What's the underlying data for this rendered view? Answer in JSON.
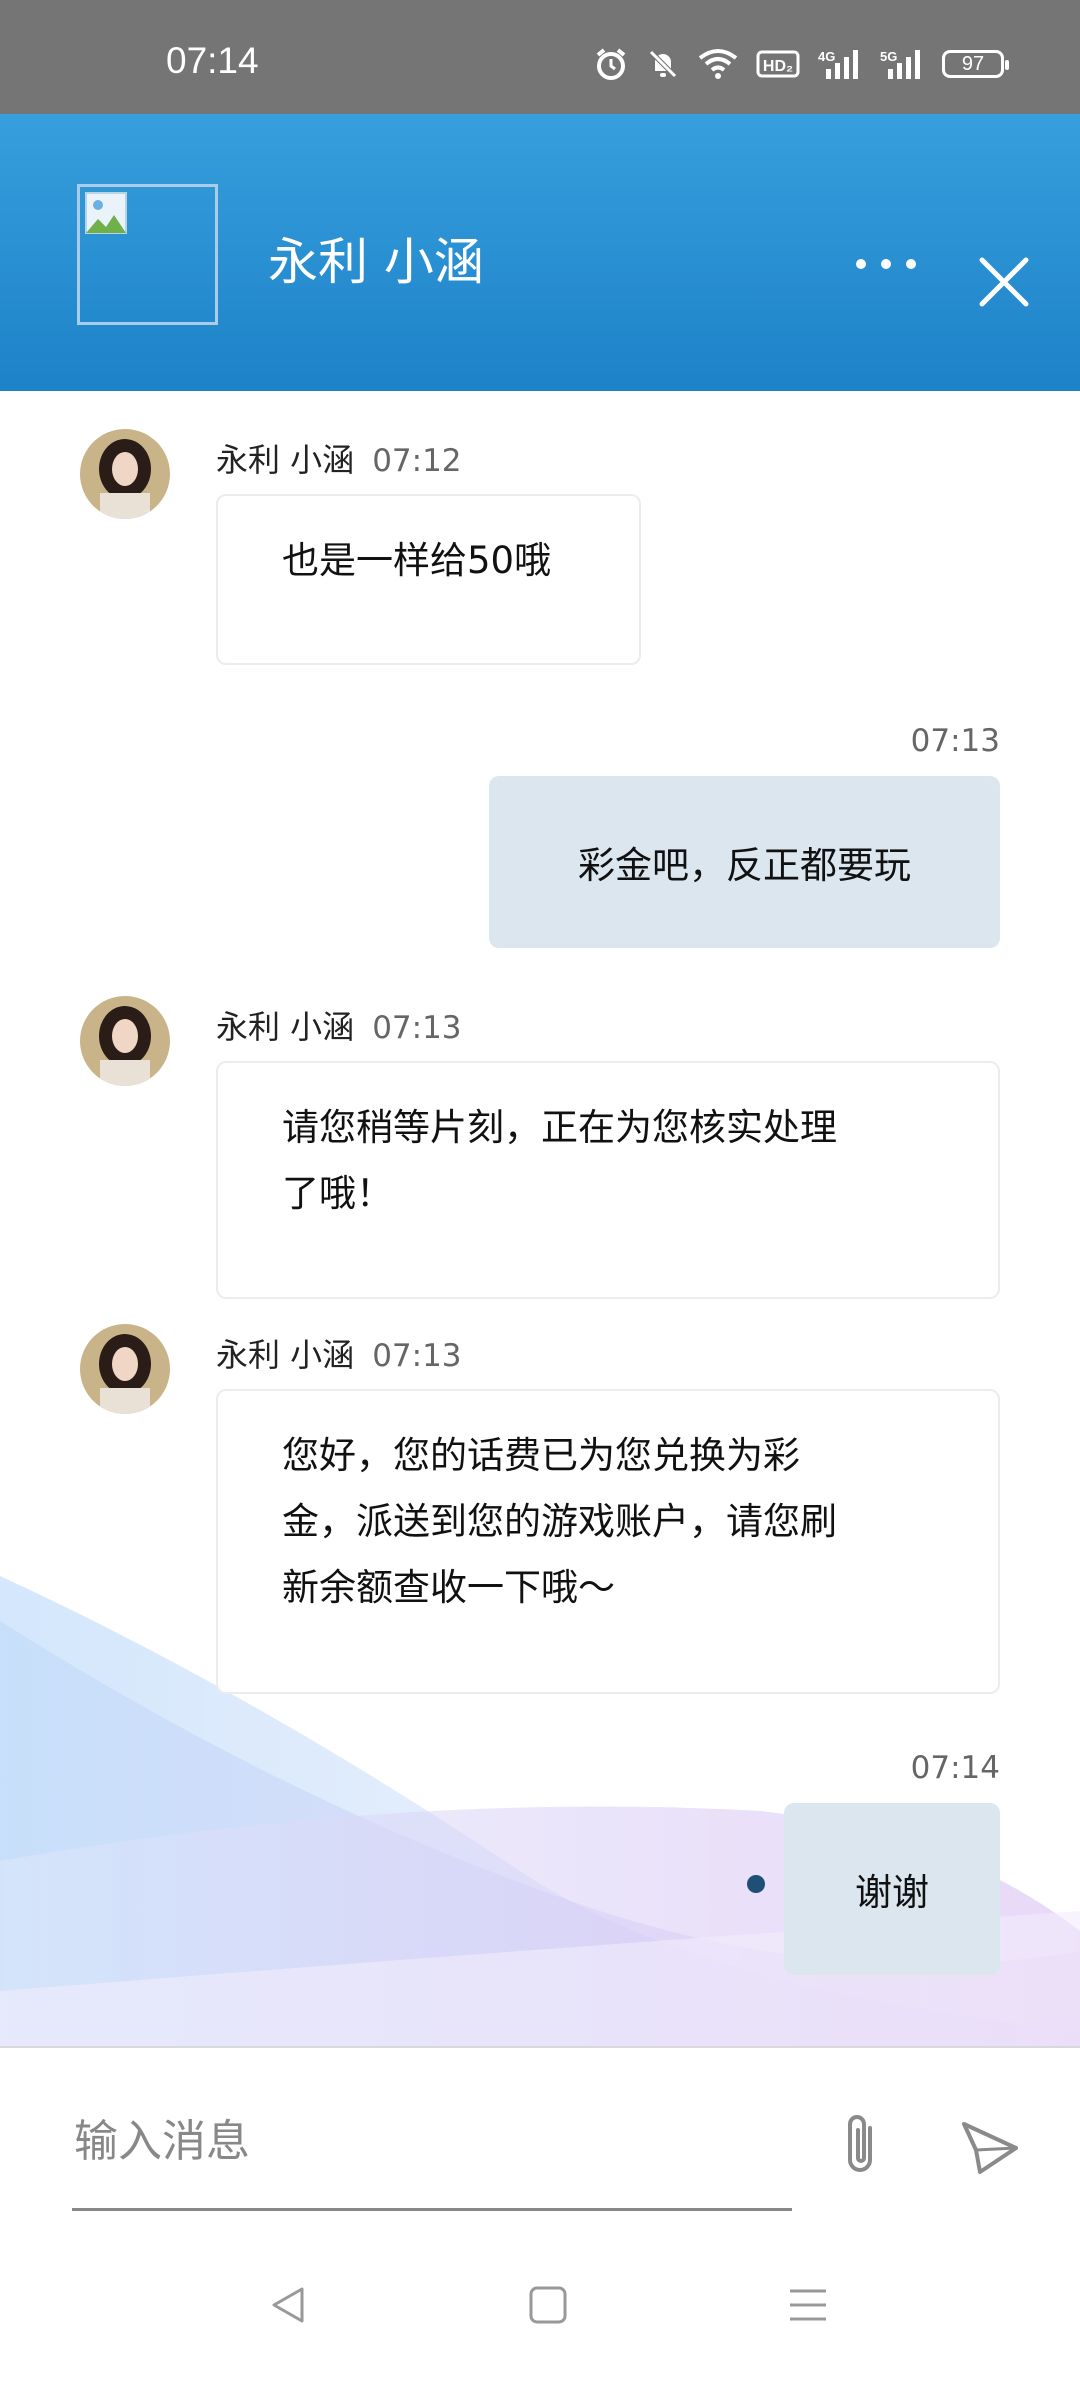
{
  "status_bar": {
    "time": "07:14",
    "icons": [
      "alarm-icon",
      "mute-icon",
      "wifi-icon",
      "hd-icon",
      "signal-4g-icon",
      "signal-5g-icon"
    ],
    "hd_label": "HD₂",
    "sig1_label": "4G",
    "sig2_label": "5G",
    "battery": "97"
  },
  "header": {
    "title": "永利 小涵",
    "more_icon": "more-horizontal-icon",
    "close_icon": "close-icon",
    "background_color": "#2a91d4"
  },
  "messages": [
    {
      "direction": "in",
      "sender": "永利 小涵",
      "time": "07:12",
      "text": "也是一样给50哦"
    },
    {
      "direction": "out",
      "time": "07:13",
      "text": "彩金吧，反正都要玩"
    },
    {
      "direction": "in",
      "sender": "永利 小涵",
      "time": "07:13",
      "lines": [
        "请您稍等片刻，正在为您核实处理",
        "了哦！"
      ]
    },
    {
      "direction": "in",
      "sender": "永利 小涵",
      "time": "07:13",
      "lines": [
        "您好，您的话费已为您兑换为彩",
        "金，派送到您的游戏账户，请您刷",
        "新余额查收一下哦～"
      ]
    },
    {
      "direction": "out",
      "time": "07:14",
      "text": "谢谢"
    }
  ],
  "input": {
    "placeholder": "输入消息",
    "attach_icon": "paperclip-icon",
    "send_icon": "send-icon"
  },
  "navbar": {
    "icons": [
      "back-icon",
      "home-icon",
      "menu-icon"
    ]
  },
  "colors": {
    "outgoing_bubble": "#dbe6ef",
    "incoming_bubble": "#ffffff",
    "sent_dot": "#1e4f74"
  }
}
